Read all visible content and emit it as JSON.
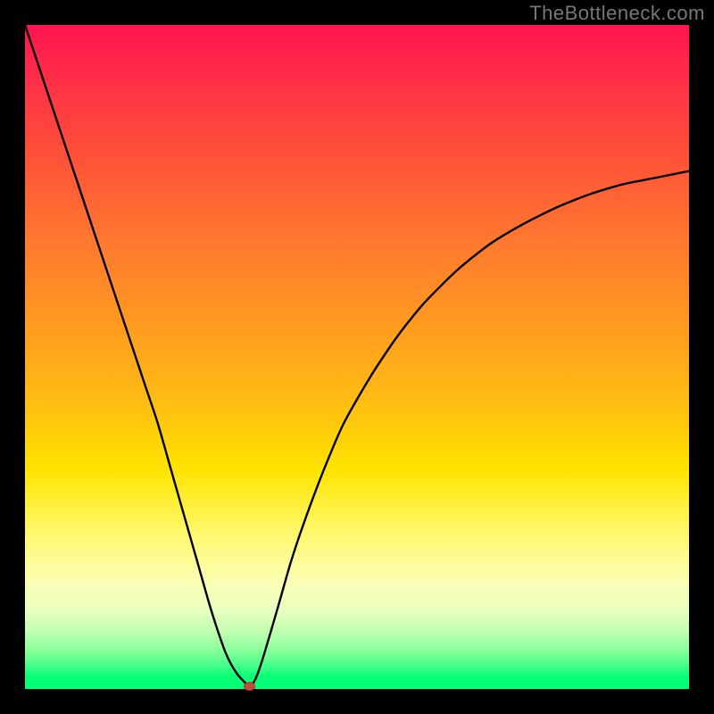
{
  "watermark": "TheBottleneck.com",
  "chart_data": {
    "type": "line",
    "title": "",
    "xlabel": "",
    "ylabel": "",
    "xlim": [
      0,
      100
    ],
    "ylim": [
      0,
      100
    ],
    "grid": false,
    "legend": false,
    "series": [
      {
        "name": "curve",
        "x": [
          0,
          2,
          4,
          6,
          8,
          10,
          12,
          14,
          16,
          18,
          20,
          22,
          24,
          26,
          28,
          30,
          31,
          32,
          33,
          33.8,
          34.2,
          35,
          36,
          38,
          40,
          42,
          45,
          48,
          52,
          56,
          60,
          65,
          70,
          75,
          80,
          85,
          90,
          95,
          100
        ],
        "y": [
          100,
          94,
          88,
          82,
          76,
          70,
          64,
          58,
          52,
          46,
          40,
          33,
          26,
          19,
          12,
          6,
          3.8,
          2.2,
          1.1,
          0.3,
          0.6,
          2.2,
          5.2,
          12,
          19,
          25,
          33,
          40,
          47,
          53,
          58,
          63,
          67,
          70,
          72.5,
          74.5,
          76,
          77,
          78
        ]
      }
    ],
    "minimum_marker": {
      "x": 33.8,
      "y": 0.0
    },
    "background_gradient": {
      "top": "#ff1450",
      "mid_upper": "#ff9a20",
      "mid": "#ffe400",
      "mid_lower": "#fbffb5",
      "bottom": "#00ff76"
    }
  }
}
